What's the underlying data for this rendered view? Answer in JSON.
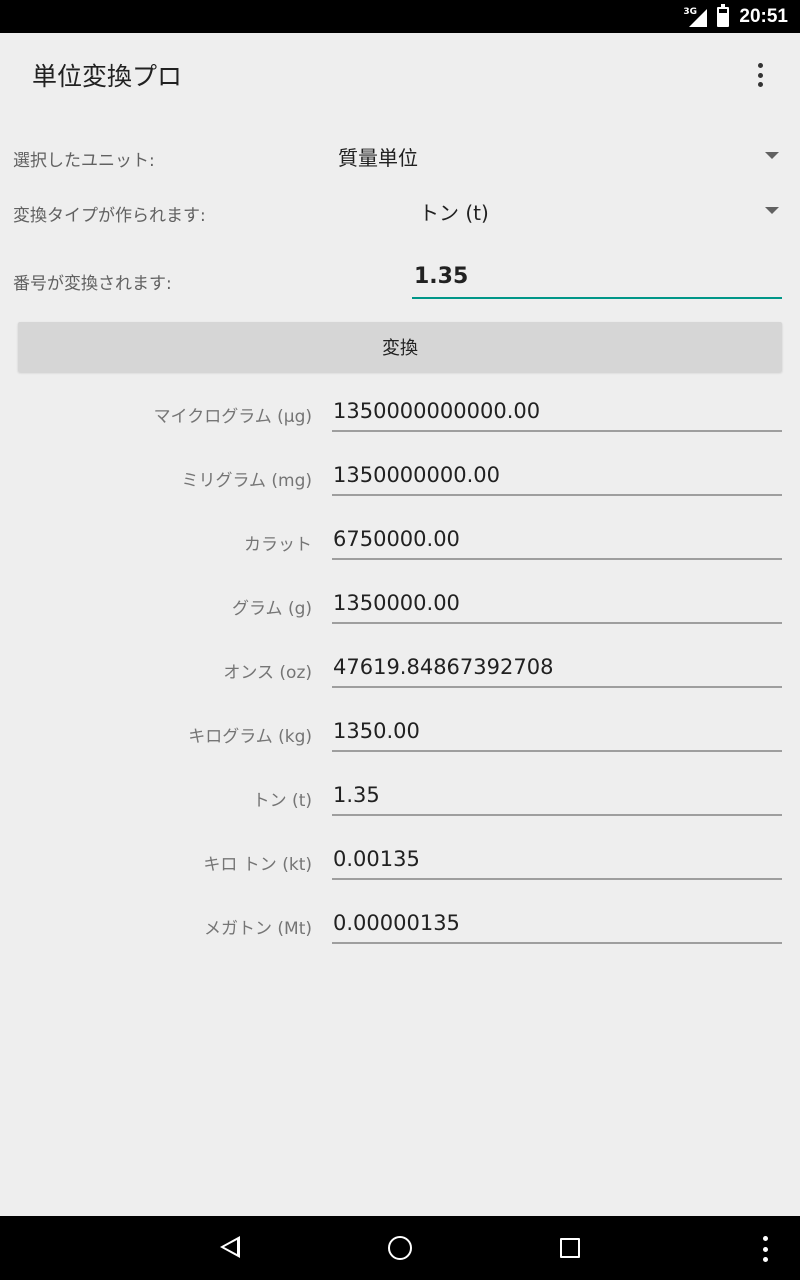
{
  "status_bar": {
    "network": "3G",
    "time": "20:51"
  },
  "app_bar": {
    "title": "単位変換プロ",
    "menu_icon": "overflow-menu-icon"
  },
  "form": {
    "unit_label": "選択したユニット:",
    "unit_value": "質量単位",
    "type_label": "変換タイプが作られます:",
    "type_value": "トン (t)",
    "number_label": "番号が変換されます:",
    "number_value": "1.35",
    "convert_button": "変換"
  },
  "results": [
    {
      "label": "マイクログラム (μg)",
      "value": "1350000000000.00"
    },
    {
      "label": "ミリグラム (mg)",
      "value": "1350000000.00"
    },
    {
      "label": "カラット",
      "value": "6750000.00"
    },
    {
      "label": "グラム (g)",
      "value": "1350000.00"
    },
    {
      "label": "オンス (oz)",
      "value": "47619.84867392708"
    },
    {
      "label": "キログラム (kg)",
      "value": "1350.00"
    },
    {
      "label": "トン (t)",
      "value": "1.35"
    },
    {
      "label": "キロ トン (kt)",
      "value": "0.00135"
    },
    {
      "label": "メガトン (Mt)",
      "value": "0.00000135"
    }
  ],
  "colors": {
    "accent": "#009688",
    "background": "#eeeeee",
    "button": "#d6d6d6"
  }
}
